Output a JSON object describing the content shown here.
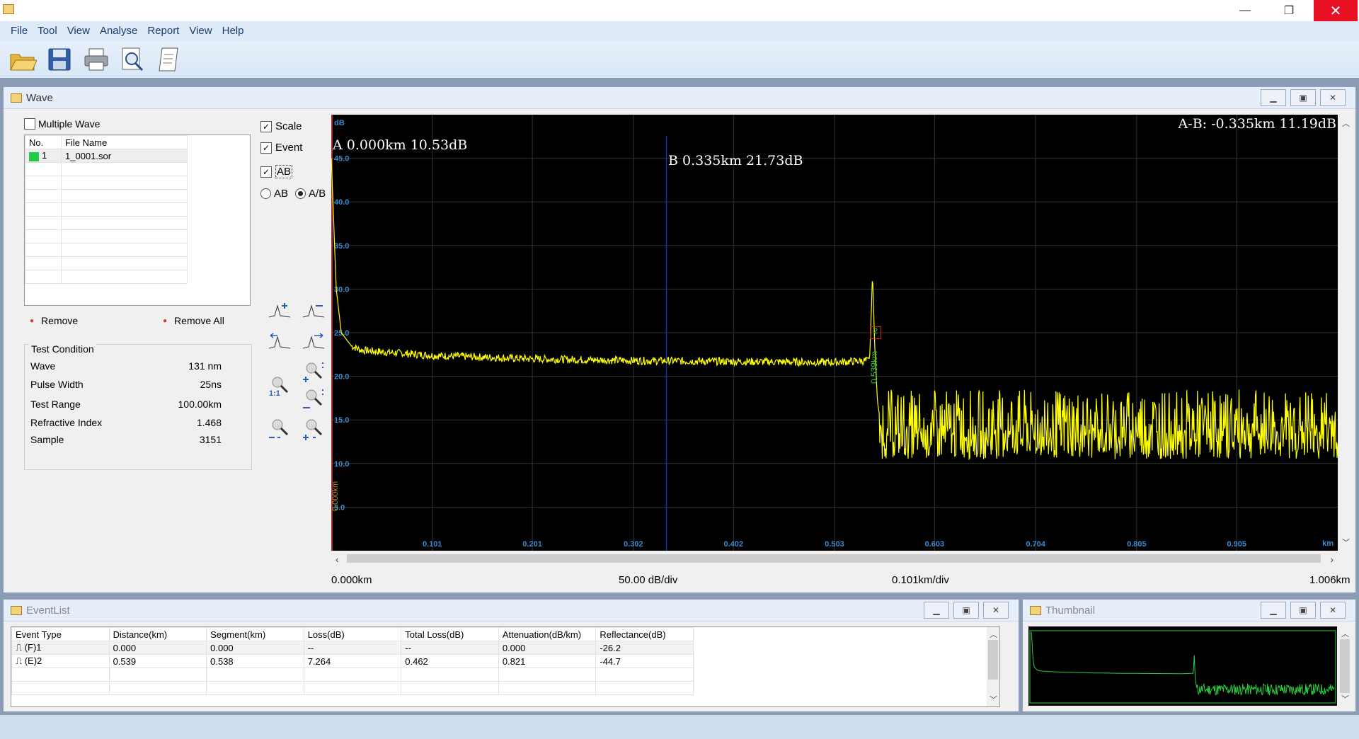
{
  "window": {
    "minimize": "—",
    "restore": "❐",
    "close": "✕"
  },
  "menu": [
    "File",
    "Tool",
    "View",
    "Analyse",
    "Report",
    "View",
    "Help"
  ],
  "toolbar": {
    "icons": [
      "open-folder-icon",
      "save-icon",
      "print-icon",
      "print-preview-icon",
      "report-icon"
    ]
  },
  "wave_window": {
    "title": "Wave",
    "multiple_wave_label": "Multiple Wave",
    "multiple_wave_checked": false,
    "file_table": {
      "headers": [
        "No.",
        "File Name"
      ],
      "rows": [
        {
          "no": "1",
          "name": "1_0001.sor",
          "color": "#22cc44"
        }
      ]
    },
    "remove_label": "Remove",
    "remove_all_label": "Remove All",
    "test_condition": {
      "title": "Test Condition",
      "rows": [
        {
          "label": "Wave",
          "value": "131 nm"
        },
        {
          "label": "Pulse Width",
          "value": "25ns"
        },
        {
          "label": "Test Range",
          "value": "100.00km"
        },
        {
          "label": "Refractive Index",
          "value": "1.468"
        },
        {
          "label": "Sample",
          "value": "3151"
        }
      ]
    },
    "options": {
      "scale": "Scale",
      "event": "Event",
      "ab": "AB",
      "radio_ab": "AB",
      "radio_a_over_b": "A/B"
    },
    "zoom_labels": {
      "one_to_one": "1:1"
    },
    "plot": {
      "unit_y": "dB",
      "unit_x": "km",
      "cursor_a": "A 0.000km 10.53dB",
      "cursor_b": "B 0.335km 21.73dB",
      "delta": "A-B: -0.335km 11.19dB",
      "event_marker": "0.539km",
      "start_marker": "0.000km",
      "event_number": "2"
    },
    "footer": {
      "start": "0.000km",
      "ydiv": "50.00 dB/div",
      "xdiv": "0.101km/div",
      "end": "1.006km"
    },
    "accent": "#ffff00"
  },
  "chart_data": {
    "type": "line",
    "title": "",
    "xlabel": "km",
    "ylabel": "dB",
    "xlim": [
      0,
      1.006
    ],
    "ylim": [
      0,
      50
    ],
    "x_ticks": [
      "0.101",
      "0.201",
      "0.302",
      "0.402",
      "0.503",
      "0.603",
      "0.704",
      "0.805",
      "0.905"
    ],
    "y_ticks": [
      "45.0",
      "40.0",
      "35.0",
      "30.0",
      "25.0",
      "20.0",
      "15.0",
      "10.0",
      "5.0"
    ],
    "series": [
      {
        "color": "#ffff00",
        "x": [
          0.0,
          0.005,
          0.01,
          0.02,
          0.03,
          0.05,
          0.1,
          0.2,
          0.3,
          0.4,
          0.5,
          0.538,
          0.54,
          0.541,
          0.543,
          0.546,
          0.55,
          0.6,
          0.7,
          0.8,
          0.9,
          1.0
        ],
        "values": [
          45.0,
          30.0,
          25.0,
          23.5,
          23.0,
          22.8,
          22.4,
          22.0,
          21.8,
          21.7,
          21.6,
          21.8,
          28.0,
          32.0,
          24.0,
          17.0,
          14.0,
          14.0,
          14.0,
          14.0,
          14.0,
          14.0
        ]
      }
    ],
    "cursors": {
      "A": 0.0,
      "B": 0.335
    }
  },
  "event_list": {
    "title": "EventList",
    "headers": [
      "Event Type",
      "Distance(km)",
      "Segment(km)",
      "Loss(dB)",
      "Total Loss(dB)",
      "Attenuation(dB/km)",
      "Reflectance(dB)"
    ],
    "rows": [
      [
        "⎍ (F)1",
        "0.000",
        "0.000",
        "--",
        "--",
        "0.000",
        "-26.2"
      ],
      [
        "⎍ (E)2",
        "0.539",
        "0.538",
        "7.264",
        "0.462",
        "0.821",
        "-44.7"
      ]
    ]
  },
  "thumbnail": {
    "title": "Thumbnail"
  }
}
